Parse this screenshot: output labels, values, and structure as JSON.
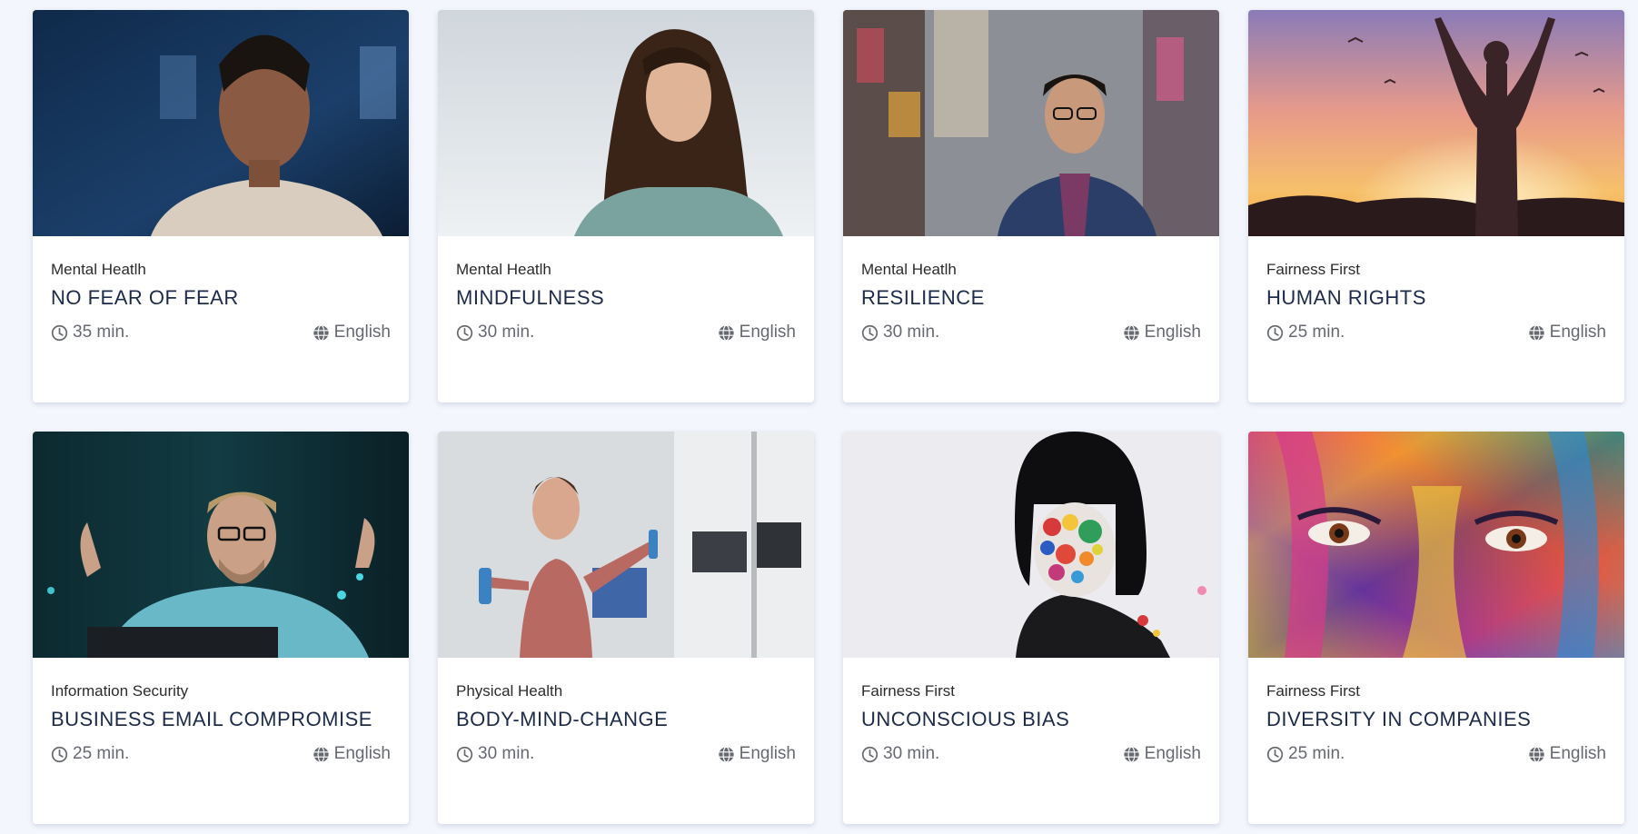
{
  "courses": [
    {
      "category": "Mental Heatlh",
      "title": "NO FEAR OF FEAR",
      "duration": "35 min.",
      "language": "English",
      "image": "woman-blue-office-photo"
    },
    {
      "category": "Mental Heatlh",
      "title": "MINDFULNESS",
      "duration": "30 min.",
      "language": "English",
      "image": "woman-sky-photo"
    },
    {
      "category": "Mental Heatlh",
      "title": "RESILIENCE",
      "duration": "30 min.",
      "language": "English",
      "image": "man-city-street-photo"
    },
    {
      "category": "Fairness First",
      "title": "HUMAN RIGHTS",
      "duration": "25 min.",
      "language": "English",
      "image": "sunset-silhouette-photo"
    },
    {
      "category": "Information Security",
      "title": "BUSINESS EMAIL COMPROMISE",
      "duration": "25 min.",
      "language": "English",
      "image": "frustrated-man-laptop-photo"
    },
    {
      "category": "Physical Health",
      "title": "BODY-MIND-CHANGE",
      "duration": "30 min.",
      "language": "English",
      "image": "woman-dumbbell-office-photo"
    },
    {
      "category": "Fairness First",
      "title": "UNCONSCIOUS BIAS",
      "duration": "30 min.",
      "language": "English",
      "image": "painted-dots-face-photo"
    },
    {
      "category": "Fairness First",
      "title": "DIVERSITY IN COMPANIES",
      "duration": "25 min.",
      "language": "English",
      "image": "colorful-painted-face-photo"
    }
  ]
}
